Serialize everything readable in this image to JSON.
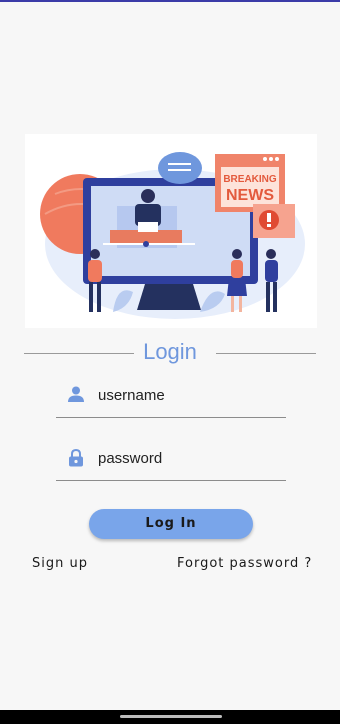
{
  "colors": {
    "accent": "#6f97dd",
    "button": "#79a5ea",
    "background": "#f7f7f7"
  },
  "hero": {
    "icon": "breaking-news-illustration",
    "badge_line1": "BREAKING",
    "badge_line2": "NEWS"
  },
  "login": {
    "title": "Login",
    "username": {
      "icon": "person-icon",
      "value": "username"
    },
    "password": {
      "icon": "lock-icon",
      "value": "password"
    },
    "submit_label": "Log In"
  },
  "links": {
    "signup": "Sign up",
    "forgot": "Forgot password ?"
  }
}
